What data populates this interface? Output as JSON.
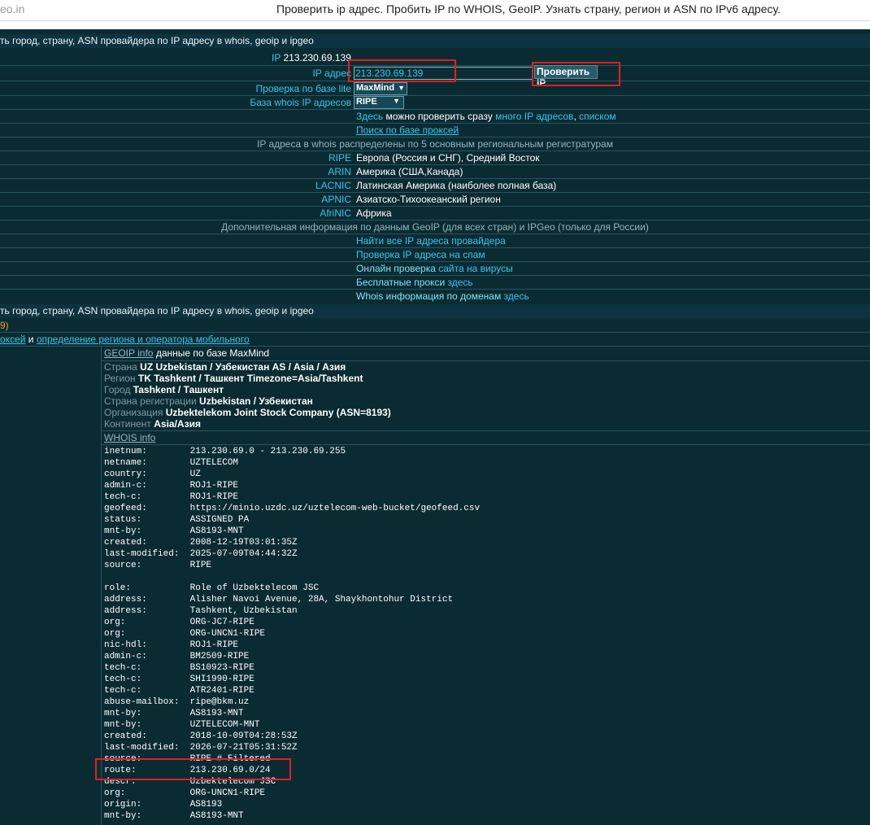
{
  "browser": {
    "domain": "eo.in",
    "tab_title": "Проверить ip адрес. Пробить IP по WHOIS, GeoIP. Узнать страну, регион и ASN по IPv6 адресу."
  },
  "header_text": "ть город, страну, ASN провайдера по IP адресу в whois, geoip и ipgeo",
  "ip_label": "IP",
  "ip_value": "213.230.69.139",
  "form": {
    "ip_label": "IP адрес",
    "ip_input_value": "213.230.69.139",
    "check_button": "Проверить IP",
    "lite_label": "Проверка по базе lite",
    "lite_selected": "MaxMind",
    "whois_label": "База whois IP адресов",
    "whois_selected": "RIPE"
  },
  "links": {
    "many_prefix": "Здесь ",
    "many_mid": "можно проверить сразу",
    "many_link": " много IP адресов",
    "many_sep": ", ",
    "many_list": "списком",
    "proxy_search": "Поиск по базе проксей"
  },
  "registries_note": "IP адреса в whois распределены по 5 основным региональным регистратурам",
  "registries": [
    {
      "name": "RIPE",
      "desc": "Европа (Россия и СНГ), Средний Восток"
    },
    {
      "name": "ARIN",
      "desc": "Америка (США,Канада)"
    },
    {
      "name": "LACNIC",
      "desc": "Латинская Америка (наиболее полная база)"
    },
    {
      "name": "APNIC",
      "desc": "Азиатско-Тихоокеанский регион"
    },
    {
      "name": "AfriNIC",
      "desc": "Африка"
    }
  ],
  "geoip_note": "Дополнительная информация по данным GeoIP (для всех стран) и IPGeo (только для России)",
  "extra_links": [
    {
      "a": "Найти все IP адреса провайдера",
      "b": ""
    },
    {
      "a": "Проверка IP адреса на спам",
      "b": ""
    },
    {
      "a": "Онлайн проверка",
      "b": " сайта на вирусы"
    },
    {
      "a": "Бесплатные прокси",
      "b": " здесь"
    },
    {
      "a": "Whois информация по доменам",
      "b": " здесь"
    }
  ],
  "header_text_2": "ть город, страну, ASN провайдера по IP адресу в whois, geoip и ipgeo",
  "paren_line": "9)",
  "proxies_line": {
    "a": "оксей",
    "b": " и ",
    "c": "определение региона и оператора мобильного"
  },
  "geoip_info": {
    "title": "GEOIP info",
    "suffix": " данные по базе MaxMind",
    "rows": [
      {
        "k": "Страна ",
        "v": "UZ Uzbekistan / Узбекистан AS / Asia / Азия"
      },
      {
        "k": "Регион ",
        "v": "TK Tashkent / Ташкент Timezone=Asia/Tashkent"
      },
      {
        "k": "Город ",
        "v": "Tashkent / Ташкент"
      },
      {
        "k": "Страна регистрации ",
        "v": "Uzbekistan / Узбекистан"
      },
      {
        "k": "Организация ",
        "v": "Uzbektelekom Joint Stock Company (ASN=8193)"
      },
      {
        "k": "Континент ",
        "v": "Asia/Азия"
      }
    ]
  },
  "whois_info_title": "WHOIS info",
  "whois_text": "inetnum:        213.230.69.0 - 213.230.69.255\nnetname:        UZTELECOM\ncountry:        UZ\nadmin-c:        ROJ1-RIPE\ntech-c:         ROJ1-RIPE\ngeofeed:        https://minio.uzdc.uz/uztelecom-web-bucket/geofeed.csv\nstatus:         ASSIGNED PA\nmnt-by:         AS8193-MNT\ncreated:        2008-12-19T03:01:35Z\nlast-modified:  2025-07-09T04:44:32Z\nsource:         RIPE\n\nrole:           Role of Uzbektelecom JSC\naddress:        Alisher Navoi Avenue, 28A, Shaykhontohur District\naddress:        Tashkent, Uzbekistan\norg:            ORG-JC7-RIPE\norg:            ORG-UNCN1-RIPE\nnic-hdl:        ROJ1-RIPE\nadmin-c:        BM2509-RIPE\ntech-c:         BS10923-RIPE\ntech-c:         SHI1990-RIPE\ntech-c:         ATR2401-RIPE\nabuse-mailbox:  ripe@bkm.uz\nmnt-by:         AS8193-MNT\nmnt-by:         UZTELECOM-MNT\ncreated:        2018-10-09T04:28:53Z\nlast-modified:  2026-07-21T05:31:52Z\nsource:         RIPE # Filtered\nroute:          213.230.69.0/24\ndescr:          Uzbektelecom JSC\norg:            ORG-UNCN1-RIPE\norigin:         AS8193\nmnt-by:         AS8193-MNT",
  "colors": {
    "background": "#0b2b33",
    "link": "#37c6ea",
    "highlight": "#e02020"
  }
}
